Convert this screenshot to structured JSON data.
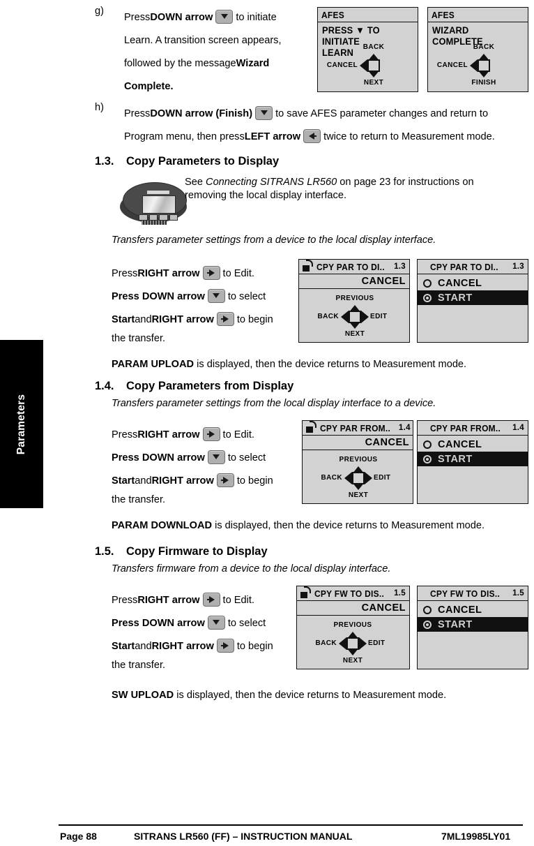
{
  "sidebar": {
    "tab_label": "Parameters"
  },
  "steps": [
    {
      "marker": "g)",
      "lines": [
        [
          {
            "t": "Press ",
            "s": "n"
          },
          {
            "t": "DOWN arrow",
            "s": "b"
          },
          {
            "k": "down"
          },
          {
            "t": " to initiate",
            "s": "n"
          }
        ],
        [
          {
            "t": "Learn. A transition screen appears,",
            "s": "n"
          }
        ],
        [
          {
            "t": "followed by the message ",
            "s": "n"
          },
          {
            "t": "Wizard",
            "s": "b"
          }
        ],
        [
          {
            "t": "Complete.",
            "s": "b"
          }
        ]
      ]
    },
    {
      "marker": "h)",
      "lines": [
        [
          {
            "t": "Press ",
            "s": "n"
          },
          {
            "t": "DOWN arrow (Finish)",
            "s": "b"
          },
          {
            "k": "down"
          },
          {
            "t": " to save AFES parameter changes and return to",
            "s": "n"
          }
        ],
        [
          {
            "t": "Program menu, then press ",
            "s": "n"
          },
          {
            "t": "LEFT arrow",
            "s": "b"
          },
          {
            "k": "left"
          },
          {
            "t": " twice to return to Measurement mode.",
            "s": "n"
          }
        ]
      ]
    }
  ],
  "afes_panels": [
    {
      "title": "AFES",
      "message_lines": [
        "PRESS ▼ TO INITIATE",
        "LEARN"
      ],
      "nav": {
        "up": "BACK",
        "down": "NEXT",
        "left": "CANCEL",
        "right": ""
      }
    },
    {
      "title": "AFES",
      "message_lines": [
        "WIZARD COMPLETE"
      ],
      "nav": {
        "up": "BACK",
        "down": "FINISH",
        "left": "CANCEL",
        "right": ""
      }
    }
  ],
  "sections": [
    {
      "number": "1.3.",
      "heading": "Copy Parameters to Display",
      "note_lines": [
        "See Connecting SITRANS LR560  on page 23 for instructions on",
        "removing the local display interface."
      ],
      "note_italic_part": "Connecting SITRANS LR560",
      "intro": "Transfers parameter settings from a device to the local display interface.",
      "instr": [
        [
          {
            "t": "Press ",
            "s": "n"
          },
          {
            "t": "RIGHT arrow",
            "s": "b"
          },
          {
            "k": "right"
          },
          {
            "t": " to Edit.",
            "s": "n"
          }
        ],
        [
          {
            "t": "Press DOWN arrow",
            "s": "b"
          },
          {
            "k": "down"
          },
          {
            "t": " to select",
            "s": "n"
          }
        ],
        [
          {
            "t": "Start",
            "s": "b"
          },
          {
            "t": " and ",
            "s": "n"
          },
          {
            "t": "RIGHT arrow",
            "s": "b"
          },
          {
            "k": "right"
          },
          {
            "t": " to begin",
            "s": "n"
          }
        ],
        [
          {
            "t": "the transfer.",
            "s": "n"
          }
        ]
      ],
      "result": [
        {
          "t": "PARAM UPLOAD",
          "s": "b"
        },
        {
          "t": " is displayed, then the device returns to Measurement mode.",
          "s": "n"
        }
      ],
      "lcd_nav": {
        "locked_icon": "unlock-icon",
        "title": "CPY PAR TO  DI..",
        "index": "1.3",
        "value_row": "CANCEL",
        "nav": {
          "up": "PREVIOUS",
          "down": "NEXT",
          "left": "BACK",
          "right": "EDIT"
        }
      },
      "lcd_opts": {
        "title": "CPY PAR TO DI..",
        "index": "1.3",
        "options": [
          {
            "label": "CANCEL",
            "selected": false
          },
          {
            "label": "START",
            "selected": true
          }
        ]
      }
    },
    {
      "number": "1.4.",
      "heading": "Copy Parameters from Display",
      "note_lines": [],
      "note_italic_part": "",
      "intro": "Transfers parameter settings from the local display interface to a device.",
      "instr": [
        [
          {
            "t": "Press ",
            "s": "n"
          },
          {
            "t": "RIGHT arrow",
            "s": "b"
          },
          {
            "k": "right"
          },
          {
            "t": " to Edit.",
            "s": "n"
          }
        ],
        [
          {
            "t": "Press DOWN arrow",
            "s": "b"
          },
          {
            "k": "down"
          },
          {
            "t": " to select",
            "s": "n"
          }
        ],
        [
          {
            "t": "Start",
            "s": "b"
          },
          {
            "t": " and ",
            "s": "n"
          },
          {
            "t": "RIGHT arrow",
            "s": "b"
          },
          {
            "k": "right"
          },
          {
            "t": " to begin",
            "s": "n"
          }
        ],
        [
          {
            "t": "the transfer.",
            "s": "n"
          }
        ]
      ],
      "result": [
        {
          "t": "PARAM DOWNLOAD",
          "s": "b"
        },
        {
          "t": " is displayed, then the device returns to Measurement mode.",
          "s": "n"
        }
      ],
      "lcd_nav": {
        "locked_icon": "unlock-icon",
        "title": "CPY PAR FROM..",
        "index": "1.4",
        "value_row": "CANCEL",
        "nav": {
          "up": "PREVIOUS",
          "down": "NEXT",
          "left": "BACK",
          "right": "EDIT"
        }
      },
      "lcd_opts": {
        "title": "CPY PAR FROM..",
        "index": "1.4",
        "options": [
          {
            "label": "CANCEL",
            "selected": false
          },
          {
            "label": "START",
            "selected": true
          }
        ]
      }
    },
    {
      "number": "1.5.",
      "heading": "Copy Firmware to Display",
      "note_lines": [],
      "note_italic_part": "",
      "intro": "Transfers firmware from a device to the local display interface.",
      "instr": [
        [
          {
            "t": "Press ",
            "s": "n"
          },
          {
            "t": "RIGHT arrow",
            "s": "b"
          },
          {
            "k": "right"
          },
          {
            "t": " to Edit.",
            "s": "n"
          }
        ],
        [
          {
            "t": "Press DOWN arrow",
            "s": "b"
          },
          {
            "k": "down"
          },
          {
            "t": " to select",
            "s": "n"
          }
        ],
        [
          {
            "t": "Start",
            "s": "b"
          },
          {
            "t": " and ",
            "s": "n"
          },
          {
            "t": "RIGHT arrow",
            "s": "b"
          },
          {
            "k": "right"
          },
          {
            "t": " to begin",
            "s": "n"
          }
        ],
        [
          {
            "t": "the transfer.",
            "s": "n"
          }
        ]
      ],
      "result": [
        {
          "t": "SW UPLOAD",
          "s": "b"
        },
        {
          "t": " is displayed, then the device returns to Measurement mode.",
          "s": "n"
        }
      ],
      "lcd_nav": {
        "locked_icon": "unlock-icon",
        "title": "CPY FW TO  DIS..",
        "index": "1.5",
        "value_row": "CANCEL",
        "nav": {
          "up": "PREVIOUS",
          "down": "NEXT",
          "left": "BACK",
          "right": "EDIT"
        }
      },
      "lcd_opts": {
        "title": "CPY FW TO DIS..",
        "index": "1.5",
        "options": [
          {
            "label": "CANCEL",
            "selected": false
          },
          {
            "label": "START",
            "selected": true
          }
        ]
      }
    }
  ],
  "footer": {
    "page": "Page 88",
    "title": "SITRANS LR560 (FF) – INSTRUCTION MANUAL",
    "docnum": "7ML19985LY01"
  },
  "colors": {
    "lcd_background": "#d2d2d2",
    "ink": "#000000",
    "key_face": "#b0b0b0",
    "tab": "#000000"
  }
}
